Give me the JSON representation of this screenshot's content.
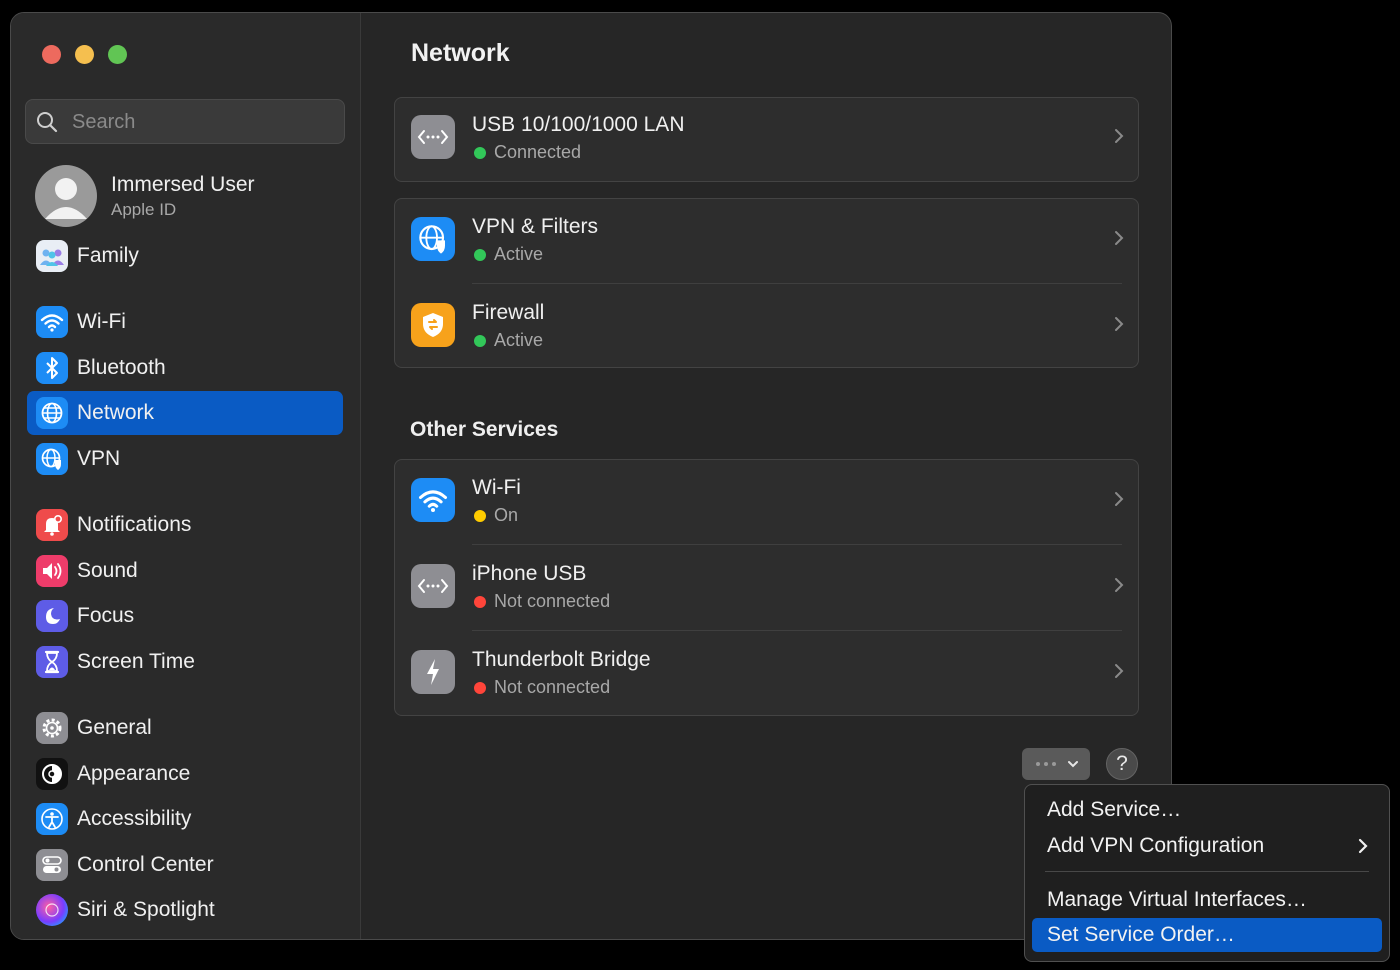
{
  "sidebar": {
    "search_placeholder": "Search",
    "account": {
      "name": "Immersed User",
      "subtitle": "Apple ID"
    },
    "items": [
      {
        "label": "Family",
        "icon": "family-icon"
      },
      {
        "label": "Wi-Fi",
        "icon": "wifi-icon"
      },
      {
        "label": "Bluetooth",
        "icon": "bluetooth-icon"
      },
      {
        "label": "Network",
        "icon": "globe-icon",
        "selected": true
      },
      {
        "label": "VPN",
        "icon": "vpn-globe-icon"
      },
      {
        "label": "Notifications",
        "icon": "bell-icon"
      },
      {
        "label": "Sound",
        "icon": "speaker-icon"
      },
      {
        "label": "Focus",
        "icon": "moon-icon"
      },
      {
        "label": "Screen Time",
        "icon": "hourglass-icon"
      },
      {
        "label": "General",
        "icon": "gear-icon"
      },
      {
        "label": "Appearance",
        "icon": "appearance-icon"
      },
      {
        "label": "Accessibility",
        "icon": "accessibility-icon"
      },
      {
        "label": "Control Center",
        "icon": "control-center-icon"
      },
      {
        "label": "Siri & Spotlight",
        "icon": "siri-icon"
      }
    ]
  },
  "main": {
    "title": "Network",
    "services": [
      {
        "title": "USB 10/100/1000 LAN",
        "status": "Connected",
        "status_color": "#32c759",
        "icon": "ethernet-icon"
      },
      {
        "title": "VPN & Filters",
        "status": "Active",
        "status_color": "#32c759",
        "icon": "vpn-globe-icon"
      },
      {
        "title": "Firewall",
        "status": "Active",
        "status_color": "#32c759",
        "icon": "firewall-shield-icon"
      }
    ],
    "other_services_title": "Other Services",
    "other_services": [
      {
        "title": "Wi-Fi",
        "status": "On",
        "status_color": "#ffcc00",
        "icon": "wifi-icon"
      },
      {
        "title": "iPhone USB",
        "status": "Not connected",
        "status_color": "#ff453a",
        "icon": "ethernet-icon"
      },
      {
        "title": "Thunderbolt Bridge",
        "status": "Not connected",
        "status_color": "#ff453a",
        "icon": "thunderbolt-icon"
      }
    ],
    "help_label": "?"
  },
  "menu": {
    "items": [
      {
        "label": "Add Service…"
      },
      {
        "label": "Add VPN Configuration",
        "submenu": true
      },
      {
        "label": "Manage Virtual Interfaces…"
      },
      {
        "label": "Set Service Order…",
        "highlighted": true
      }
    ]
  },
  "colors": {
    "accent": "#0a5bc4",
    "window_bg": "#262626",
    "sidebar_bg": "#2a2a2a"
  }
}
